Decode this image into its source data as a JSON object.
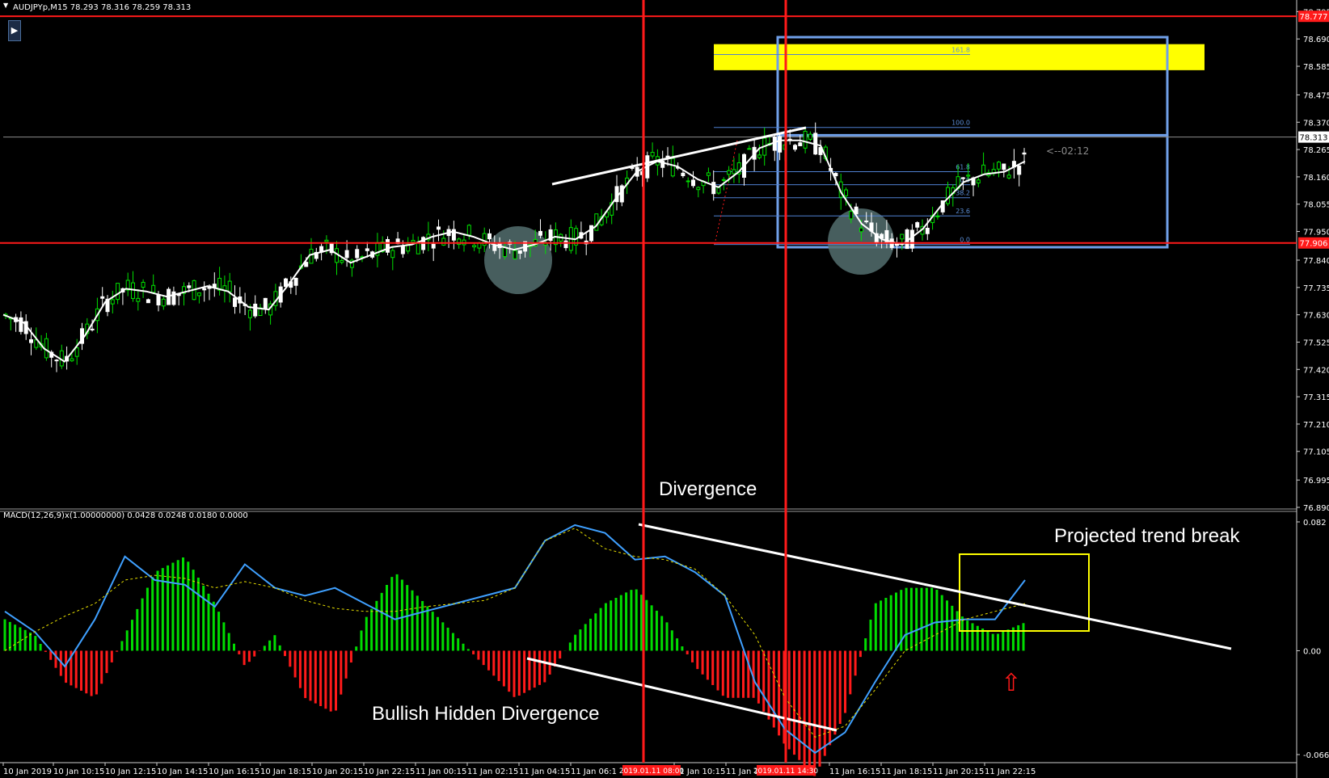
{
  "header": {
    "symbol_info": "AUDJPYp,M15  78.293 78.316 78.259 78.313",
    "macd_info": "MACD(12,26,9)x(1.00000000) 0.0428 0.0248 0.0180 0.0000"
  },
  "annotations": {
    "divergence": "Divergence",
    "bullish_hidden": "Bullish Hidden Divergence",
    "trend_break": "Projected trend break",
    "countdown": "<--02:12"
  },
  "colors": {
    "background": "#000000",
    "candle_up": "#00e000",
    "candle_down": "#ffffff",
    "ma": "#ffffff",
    "red_line": "#ff1a1a",
    "fib_box": "#6f9fe8",
    "fib_line": "#4f7fcf",
    "target_zone": "#ffff00",
    "macd_line": "#3fa0ff",
    "signal_line": "#e8e000",
    "hist_up": "#00dd00",
    "hist_down": "#ff1a1a",
    "circle": "#546e6e"
  },
  "chart_data": [
    {
      "type": "candlestick",
      "title": "AUDJPYp,M15",
      "ylim": [
        76.89,
        78.79
      ],
      "y_ticks": [
        78.795,
        78.69,
        78.585,
        78.475,
        78.37,
        78.265,
        78.16,
        78.055,
        77.95,
        77.84,
        77.735,
        77.63,
        77.525,
        77.42,
        77.315,
        77.21,
        77.105,
        76.995,
        76.89
      ],
      "y_tick_labels": [
        "78.795",
        "78.690",
        "78.585",
        "78.475",
        "78.370",
        "78.265",
        "78.160",
        "78.055",
        "77.950",
        "77.840",
        "77.735",
        "77.630",
        "77.525",
        "77.420",
        "77.315",
        "77.210",
        "77.105",
        "76.995",
        "76.890"
      ],
      "x_tick_labels": [
        "10 Jan 2019",
        "10 Jan 10:15",
        "10 Jan 12:15",
        "10 Jan 14:15",
        "10 Jan 16:15",
        "10 Jan 18:15",
        "10 Jan 20:15",
        "10 Jan 22:15",
        "11 Jan 00:15",
        "11 Jan 02:15",
        "11 Jan 04:15",
        "11 Jan 06:1",
        "11 Jan 10:15",
        "11 Jan 1",
        "11 Jan 16:15",
        "11 Jan 18:15",
        "11 Jan 20:15",
        "11 Jan 22:15"
      ],
      "x_marker_labels": [
        "2019.01.11 08:00",
        "2019.01.11 14:30"
      ],
      "price_labels": {
        "current": "78.313",
        "upper_line": "78.777",
        "lower_line": "77.906"
      },
      "horizontal_lines": [
        78.777,
        77.906
      ],
      "ma_line": [
        77.63,
        77.6,
        77.5,
        77.45,
        77.55,
        77.68,
        77.73,
        77.72,
        77.7,
        77.72,
        77.74,
        77.72,
        77.66,
        77.65,
        77.75,
        77.86,
        77.88,
        77.83,
        77.86,
        77.89,
        77.9,
        77.93,
        77.95,
        77.93,
        77.9,
        77.88,
        77.9,
        77.93,
        77.92,
        77.97,
        78.08,
        78.18,
        78.22,
        78.2,
        78.15,
        78.12,
        78.18,
        78.27,
        78.3,
        78.3,
        78.28,
        78.1,
        77.98,
        77.92,
        77.9,
        77.96,
        78.06,
        78.14,
        78.17,
        78.18,
        78.22
      ],
      "fibonacci": {
        "levels": [
          "161.8",
          "100.0",
          "61.8",
          "50.0",
          "38.2",
          "23.6",
          "0.0"
        ],
        "prices": [
          78.63,
          78.35,
          78.18,
          78.13,
          78.08,
          78.01,
          77.9
        ],
        "target_zone": [
          78.67,
          78.57
        ]
      }
    },
    {
      "type": "macd",
      "title": "MACD(12,26,9)x(1.00000000)",
      "ylim": [
        -0.0661,
        0.082
      ],
      "y_tick_labels": [
        "0.082",
        "0.00",
        "-0.0661"
      ],
      "values": {
        "macd": 0.0428,
        "signal": 0.0248,
        "histogram": 0.018,
        "zero": 0.0
      },
      "macd_line": [
        0.025,
        0.012,
        -0.01,
        0.02,
        0.06,
        0.045,
        0.042,
        0.028,
        0.055,
        0.04,
        0.035,
        0.04,
        0.03,
        0.02,
        0.025,
        0.03,
        0.035,
        0.04,
        0.07,
        0.08,
        0.075,
        0.058,
        0.06,
        0.05,
        0.035,
        -0.02,
        -0.05,
        -0.065,
        -0.052,
        -0.02,
        0.01,
        0.018,
        0.02,
        0.02,
        0.045
      ],
      "signal_line": [
        0.0,
        0.012,
        0.022,
        0.03,
        0.045,
        0.048,
        0.046,
        0.04,
        0.044,
        0.04,
        0.032,
        0.027,
        0.025,
        0.025,
        0.028,
        0.03,
        0.032,
        0.04,
        0.07,
        0.078,
        0.065,
        0.06,
        0.058,
        0.052,
        0.035,
        0.01,
        -0.03,
        -0.055,
        -0.048,
        -0.025,
        0.0,
        0.01,
        0.02,
        0.025,
        0.03
      ],
      "histogram": [
        0.02,
        0.01,
        -0.02,
        -0.03,
        0.01,
        0.05,
        0.06,
        0.03,
        -0.01,
        0.01,
        -0.03,
        -0.04,
        0.02,
        0.05,
        0.03,
        0.01,
        -0.01,
        -0.03,
        -0.02,
        0.01,
        0.03,
        0.04,
        0.02,
        -0.01,
        -0.03,
        -0.03,
        -0.06,
        -0.08,
        -0.04,
        0.03,
        0.04,
        0.04,
        0.02,
        0.01,
        0.018
      ],
      "up_arrow": "⇧"
    }
  ]
}
